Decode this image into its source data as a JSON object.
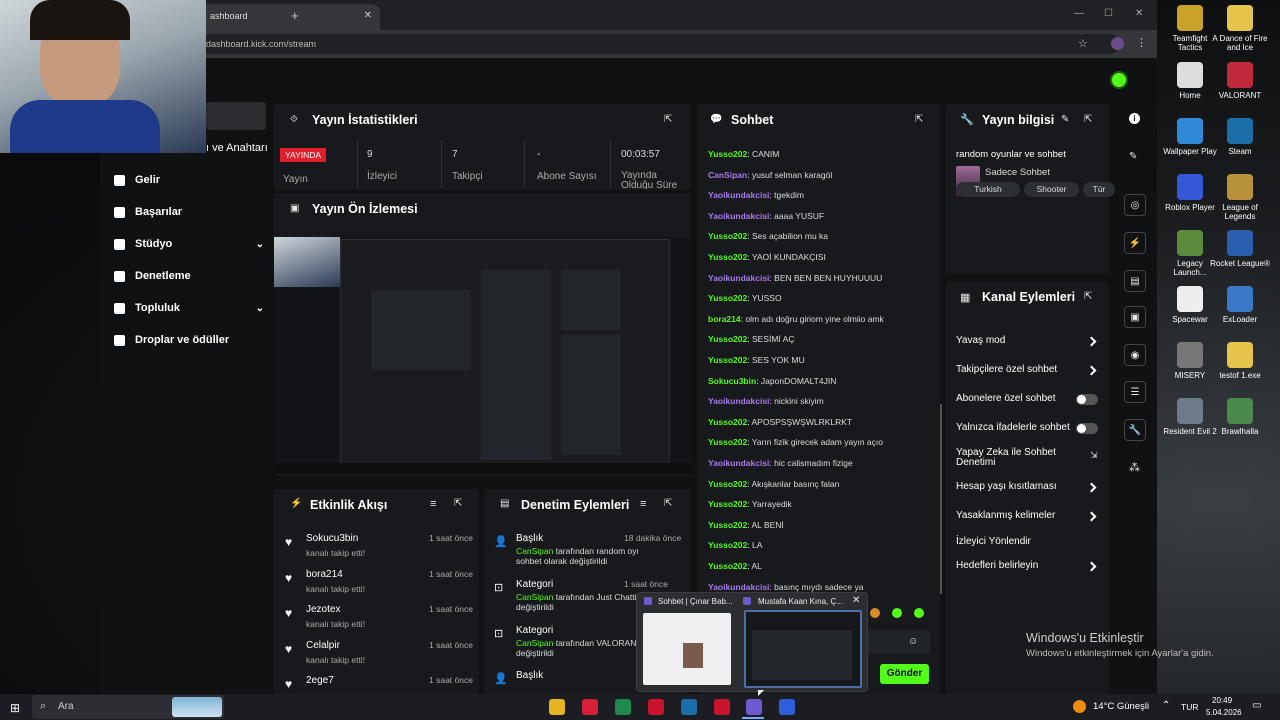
{
  "browser": {
    "tab_title": "ashboard",
    "url": "dashboard.kick.com/stream"
  },
  "sidebar": {
    "partial_label": "ı ve Anahtarı",
    "items": [
      {
        "label": "Gelir"
      },
      {
        "label": "Başarılar"
      },
      {
        "label": "Stüdyo"
      },
      {
        "label": "Denetleme"
      },
      {
        "label": "Topluluk"
      },
      {
        "label": "Droplar ve ödüller"
      }
    ]
  },
  "stats": {
    "title": "Yayın İstatistikleri",
    "live_badge": "YAYINDA",
    "live_label": "Yayın",
    "viewers_value": "9",
    "viewers_label": "İzleyici",
    "followers_value": "7",
    "followers_label": "Takipçi",
    "subs_value": "-",
    "subs_label": "Abone Sayısı",
    "uptime_value": "00:03:57",
    "uptime_label": "Yayında Olduğu Süre"
  },
  "preview": {
    "title": "Yayın Ön İzlemesi"
  },
  "activity": {
    "title": "Etkinlik Akışı",
    "items": [
      {
        "user": "Sokucu3bin",
        "text": "kanalı takip etti!",
        "time": "1 saat önce"
      },
      {
        "user": "bora214",
        "text": "kanalı takip etti!",
        "time": "1 saat önce"
      },
      {
        "user": "Jezotex",
        "text": "kanalı takip etti!",
        "time": "1 saat önce"
      },
      {
        "user": "Celalpir",
        "text": "kanalı takip etti!",
        "time": "1 saat önce"
      },
      {
        "user": "2ege7",
        "text": "",
        "time": "1 saat önce"
      }
    ]
  },
  "moderation": {
    "title": "Denetim Eylemleri",
    "items": [
      {
        "head": "Başlık",
        "time": "18 dakika önce",
        "line1a": "CanSipan",
        "line1b": " tarafından random oyunlar ve",
        "line2": "sohbet olarak değiştirildi"
      },
      {
        "head": "Kategori",
        "time": "1 saat önce",
        "line1a": "CanSipan",
        "line1b": " tarafından Just Chatti",
        "line2": "değiştirildi"
      },
      {
        "head": "Kategori",
        "time": "",
        "line1a": "CanSipan",
        "line1b": " tarafından VALORANT",
        "line2": "değiştirildi"
      },
      {
        "head": "Başlık",
        "time": "",
        "line1a": "",
        "line1b": "",
        "line2": ""
      }
    ]
  },
  "chat": {
    "title": "Sohbet",
    "messages": [
      {
        "user": "Yusso202",
        "text": "CANIM",
        "color": "green"
      },
      {
        "user": "CanSipan",
        "text": "yusuf selman karagöl",
        "color": "purple"
      },
      {
        "user": "Yaoikundakcisi",
        "text": "tgekdim",
        "color": "purple"
      },
      {
        "user": "Yaoikundakcisi",
        "text": "aaaa YUSUF",
        "color": "purple"
      },
      {
        "user": "Yusso202",
        "text": "Ses açabilion mu ka",
        "color": "green"
      },
      {
        "user": "Yusso202",
        "text": "YAOİ KUNDAKÇISI",
        "color": "green"
      },
      {
        "user": "Yaoikundakcisi",
        "text": "BEN BEN BEN HUYHUUUU",
        "color": "purple"
      },
      {
        "user": "Yusso202",
        "text": "YUSSO",
        "color": "green"
      },
      {
        "user": "bora214",
        "text": "olm adı doğru giriom yine olmiio amk",
        "color": "green"
      },
      {
        "user": "Yusso202",
        "text": "SESİMİ AÇ",
        "color": "green"
      },
      {
        "user": "Yusso202",
        "text": "SES YOK MU",
        "color": "green"
      },
      {
        "user": "Sokucu3bin",
        "text": "JaponDOMALT4JIN",
        "color": "green"
      },
      {
        "user": "Yaoikundakcisi",
        "text": "nickini skiyim",
        "color": "purple"
      },
      {
        "user": "Yusso202",
        "text": "APOSPSŞWŞWLRKLRKT",
        "color": "green"
      },
      {
        "user": "Yusso202",
        "text": "Yarın fizik girecek adam yayın açıo",
        "color": "green"
      },
      {
        "user": "Yaoikundakcisi",
        "text": "hic calismadım fizige",
        "color": "purple"
      },
      {
        "user": "Yusso202",
        "text": "Akışkanlar basınç falan",
        "color": "green"
      },
      {
        "user": "Yusso202",
        "text": "Yarrayedik",
        "color": "green"
      },
      {
        "user": "Yusso202",
        "text": "AL BENİ",
        "color": "green"
      },
      {
        "user": "Yusso202",
        "text": "LA",
        "color": "green"
      },
      {
        "user": "Yusso202",
        "text": "AL",
        "color": "green"
      },
      {
        "user": "Yaoikundakcisi",
        "text": "basınç mıydı sadece ya",
        "color": "purple"
      }
    ],
    "send_label": "Gönder"
  },
  "info": {
    "title": "Yayın bilgisi",
    "stream_title": "random oyunlar ve sohbet",
    "category": "Sadece Sohbet",
    "tags": [
      "Turkish",
      "Shooter",
      "Tür"
    ]
  },
  "actions": {
    "title": "Kanal Eylemleri",
    "items": [
      {
        "label": "Yavaş mod",
        "kind": "chevron"
      },
      {
        "label": "Takipçilere özel sohbet",
        "kind": "chevron"
      },
      {
        "label": "Abonelere özel sohbet",
        "kind": "toggle"
      },
      {
        "label": "Yalnızca ifadelerle sohbet",
        "kind": "toggle"
      },
      {
        "label": "Yapay Zeka ile Sohbet Denetimi",
        "kind": "ext"
      },
      {
        "label": "Hesap yaşı kısıtlaması",
        "kind": "chevron"
      },
      {
        "label": "Yasaklanmış kelimeler",
        "kind": "chevron"
      },
      {
        "label": "İzleyici Yönlendir",
        "kind": "none"
      },
      {
        "label": "Hedefleri belirleyin",
        "kind": "chevron"
      }
    ]
  },
  "popup": {
    "thumb1_title": "Sohbet | Çınar Bab...",
    "thumb2_title": "Mustafa Kaan Kına, Ç..."
  },
  "watermark": {
    "line1": "Windows'u Etkinleştir",
    "line2": "Windows'u etkinleştirmek için Ayarlar'a gidin."
  },
  "desktop_icons": [
    {
      "label": "Teamfight Tactics",
      "color": "#c9a227"
    },
    {
      "label": "A Dance of Fire and Ice",
      "color": "#e6c34a"
    },
    {
      "label": "Home",
      "color": "#dddddd"
    },
    {
      "label": "VALORANT",
      "color": "#c0283c"
    },
    {
      "label": "Wallpaper Play",
      "color": "#2f89d8"
    },
    {
      "label": "Steam",
      "color": "#1b6ea8"
    },
    {
      "label": "Roblox Player",
      "color": "#3557d8"
    },
    {
      "label": "League of Legends",
      "color": "#b8923a"
    },
    {
      "label": "Legacy Launch...",
      "color": "#5a8a3a"
    },
    {
      "label": "Rocket League®",
      "color": "#2a5fb0"
    },
    {
      "label": "Spacewar",
      "color": "#eeeeee"
    },
    {
      "label": "ExLoader",
      "color": "#3a78c8"
    },
    {
      "label": "MISERY",
      "color": "#777777"
    },
    {
      "label": "testof 1.exe",
      "color": "#e6c34a"
    },
    {
      "label": "Resident Evil 2",
      "color": "#6e7b8a"
    },
    {
      "label": "Brawlhalla",
      "color": "#4a8a4a"
    }
  ],
  "taskbar": {
    "search_placeholder": "Ara",
    "weather": "14°C Güneşli",
    "lang": "TUR",
    "time": "20:49",
    "date": "5.04.2026"
  },
  "colors": {
    "accent": "#53fc18",
    "live": "#e01e2c"
  }
}
